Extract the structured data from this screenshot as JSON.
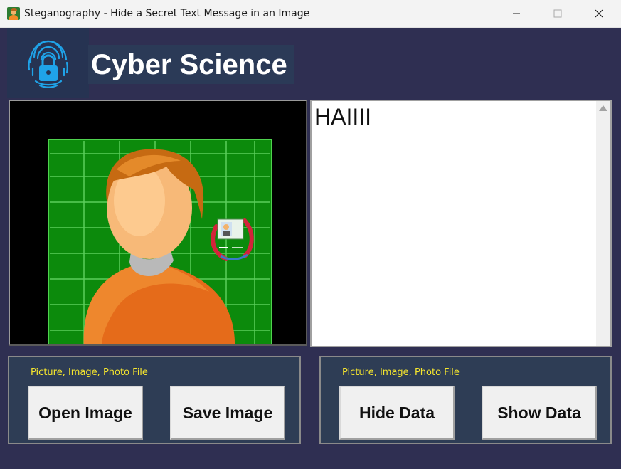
{
  "window": {
    "title": "Steganography - Hide a Secret Text Message in an Image",
    "minimize_icon": "minimize-icon",
    "maximize_icon": "maximize-icon",
    "close_icon": "close-icon"
  },
  "header": {
    "logo_icon": "fingerprint-lock-icon",
    "brand": "Cyber Science"
  },
  "message": {
    "text": "HAIIII"
  },
  "left_panel": {
    "label": "Picture, Image, Photo File",
    "open_label": "Open Image",
    "save_label": "Save Image"
  },
  "right_panel": {
    "label": "Picture, Image, Photo File",
    "hide_label": "Hide Data",
    "show_label": "Show Data"
  },
  "colors": {
    "background": "#2f2f52",
    "frame": "#2e3d55",
    "label": "#f5e52e",
    "image_grid": "#0a8a0a"
  }
}
